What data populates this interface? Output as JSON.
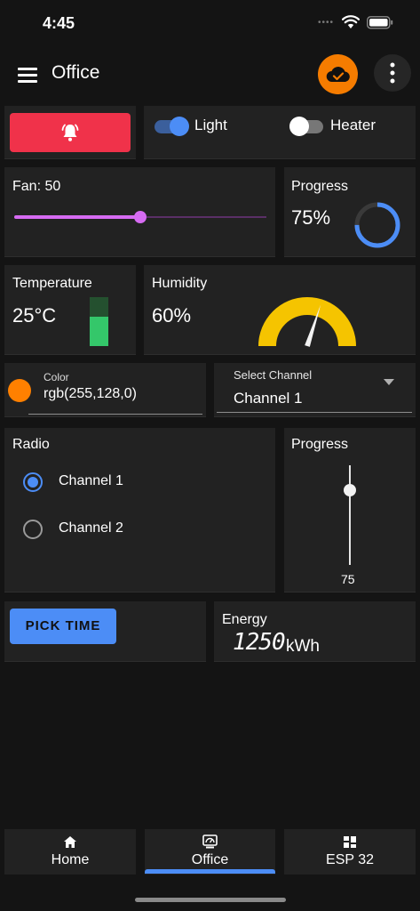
{
  "status_bar": {
    "time": "4:45",
    "dots": "••••"
  },
  "header": {
    "title": "Office",
    "menu_icon": "menu-icon",
    "cloud_icon": "cloud-check-icon",
    "more_icon": "more-vertical-icon",
    "cloud_color": "#f57c00"
  },
  "alarm": {
    "icon": "bell-ring-icon",
    "color": "#f0324a"
  },
  "switches": [
    {
      "label": "Light",
      "on": true
    },
    {
      "label": "Heater",
      "on": false
    }
  ],
  "fan": {
    "label": "Fan: 50",
    "value": 50,
    "min": 0,
    "max": 100,
    "color": "#d66bf2"
  },
  "progress_ring": {
    "label": "Progress",
    "value_text": "75%",
    "value": 75,
    "color": "#4c8df6"
  },
  "temperature": {
    "label": "Temperature",
    "value_text": "25°C",
    "level": 0.6,
    "color": "#34c76a"
  },
  "humidity": {
    "label": "Humidity",
    "value_text": "60%",
    "value": 60,
    "color": "#f5c400"
  },
  "color_input": {
    "label": "Color",
    "value": "rgb(255,128,0)",
    "swatch": "#ff8000"
  },
  "channel_select": {
    "label": "Select Channel",
    "value": "Channel 1"
  },
  "radio": {
    "label": "Radio",
    "options": [
      {
        "label": "Channel 1",
        "selected": true
      },
      {
        "label": "Channel 2",
        "selected": false
      }
    ]
  },
  "progress_vertical": {
    "label": "Progress",
    "value_text": "75",
    "value": 75
  },
  "pick_time": {
    "label": "PICK TIME"
  },
  "energy": {
    "label": "Energy",
    "value": "1250",
    "unit": "kWh"
  },
  "nav": [
    {
      "label": "Home",
      "icon": "home-icon",
      "active": false
    },
    {
      "label": "Office",
      "icon": "dashboard-icon",
      "active": true
    },
    {
      "label": "ESP 32",
      "icon": "grid-icon",
      "active": false
    }
  ],
  "accent": "#4c8df6"
}
